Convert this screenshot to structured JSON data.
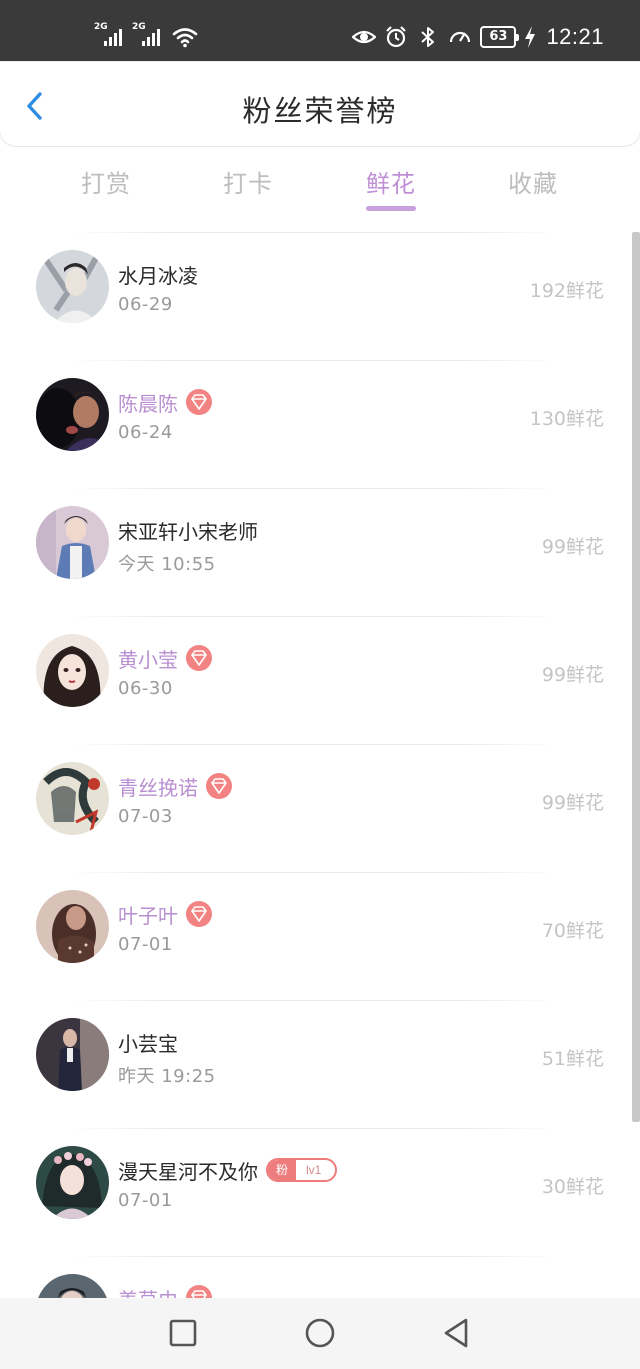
{
  "status_bar": {
    "signal1_label": "2G",
    "signal2_label": "2G",
    "battery": "63",
    "time": "12:21"
  },
  "header": {
    "title": "粉丝荣誉榜"
  },
  "tabs": [
    {
      "label": "打赏",
      "active": false
    },
    {
      "label": "打卡",
      "active": false
    },
    {
      "label": "鲜花",
      "active": true
    },
    {
      "label": "收藏",
      "active": false
    }
  ],
  "list": [
    {
      "name": "水月冰凌",
      "date": "06-29",
      "count": "192鲜花",
      "vip": false
    },
    {
      "name": "陈晨陈",
      "date": "06-24",
      "count": "130鲜花",
      "vip": true
    },
    {
      "name": "宋亚轩小宋老师",
      "date": "今天 10:55",
      "count": "99鲜花",
      "vip": false
    },
    {
      "name": "黄小莹",
      "date": "06-30",
      "count": "99鲜花",
      "vip": true
    },
    {
      "name": "青丝挽诺",
      "date": "07-03",
      "count": "99鲜花",
      "vip": true
    },
    {
      "name": "叶子叶",
      "date": "07-01",
      "count": "70鲜花",
      "vip": true
    },
    {
      "name": "小芸宝",
      "date": "昨天 19:25",
      "count": "51鲜花",
      "vip": false
    },
    {
      "name": "漫天星河不及你",
      "date": "07-01",
      "count": "30鲜花",
      "vip": false,
      "fan_badge": {
        "label": "粉",
        "level": "lv1"
      }
    },
    {
      "name": "姜草由",
      "date": "",
      "count": "",
      "vip": true
    }
  ],
  "colors": {
    "accent_purple": "#c08fd6",
    "vip_name": "#b98fd1",
    "gem_badge": "#f38282",
    "back_arrow": "#2f8de4"
  }
}
